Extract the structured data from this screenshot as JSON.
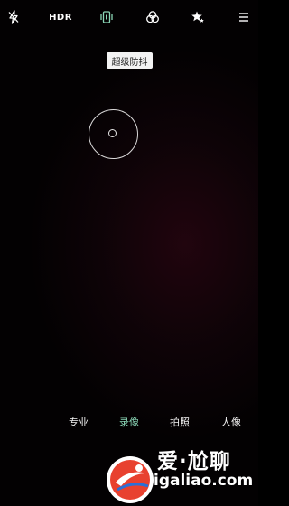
{
  "toolbar": {
    "flash": {
      "icon": "flash-off-icon"
    },
    "hdr": {
      "label": "HDR",
      "icon": "hdr-off-icon"
    },
    "stabilization": {
      "icon": "stabilization-icon",
      "active_color": "#8ad6b6"
    },
    "filters": {
      "icon": "filters-icon"
    },
    "beauty": {
      "icon": "beauty-icon"
    },
    "menu": {
      "icon": "menu-icon"
    }
  },
  "tooltip": {
    "text": "超级防抖"
  },
  "focus": {
    "icon": "focus-ring-icon"
  },
  "modes": [
    {
      "label": "专业",
      "active": false
    },
    {
      "label": "录像",
      "active": true
    },
    {
      "label": "拍照",
      "active": false
    },
    {
      "label": "人像",
      "active": false
    }
  ],
  "accent_color": "#8ad6b6",
  "watermark": {
    "title": "爱·尬聊",
    "url": "igaliao.com",
    "logo_colors": {
      "ring": "#ffffff",
      "fill": "#e8412f",
      "swoosh": "#2b6fd6"
    }
  }
}
